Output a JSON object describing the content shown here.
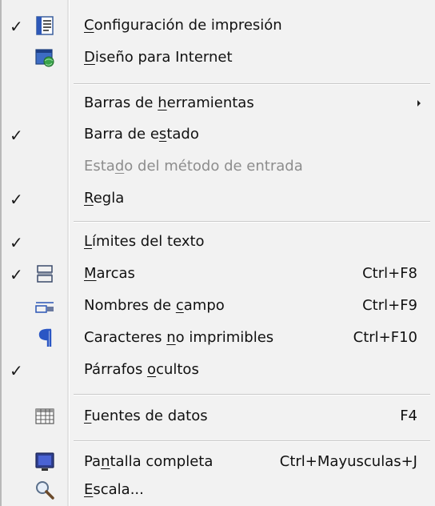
{
  "menu": {
    "items": [
      {
        "id": "configuracion",
        "pre": "",
        "mn": "C",
        "post": "onfiguración de impresión",
        "checked": true,
        "icon": "page-layout-icon",
        "shortcut": "",
        "disabled": false
      },
      {
        "id": "diseno",
        "pre": "",
        "mn": "D",
        "post": "iseño para Internet",
        "checked": false,
        "icon": "web-layout-icon",
        "shortcut": "",
        "disabled": false
      },
      {
        "id": "barras",
        "pre": "Barras de ",
        "mn": "h",
        "post": "erramientas",
        "checked": false,
        "icon": "",
        "shortcut": "",
        "disabled": false,
        "submenu": true
      },
      {
        "id": "barra-estado",
        "pre": "Barra de e",
        "mn": "s",
        "post": "tado",
        "checked": true,
        "icon": "",
        "shortcut": "",
        "disabled": false
      },
      {
        "id": "estado-metodo",
        "pre": "Esta",
        "mn": "d",
        "post": "o del método de entrada",
        "checked": false,
        "icon": "",
        "shortcut": "",
        "disabled": true
      },
      {
        "id": "regla",
        "pre": "",
        "mn": "R",
        "post": "egla",
        "checked": true,
        "icon": "",
        "shortcut": "",
        "disabled": false
      },
      {
        "id": "limites",
        "pre": "",
        "mn": "L",
        "post": "ímites del texto",
        "checked": true,
        "icon": "",
        "shortcut": "",
        "disabled": false
      },
      {
        "id": "marcas",
        "pre": "",
        "mn": "M",
        "post": "arcas",
        "checked": true,
        "icon": "field-shadings-icon",
        "shortcut": "Ctrl+F8",
        "disabled": false
      },
      {
        "id": "nombres",
        "pre": "Nombres de ",
        "mn": "c",
        "post": "ampo",
        "checked": false,
        "icon": "field-names-icon",
        "shortcut": "Ctrl+F9",
        "disabled": false
      },
      {
        "id": "caracteres",
        "pre": "Caracteres ",
        "mn": "n",
        "post": "o imprimibles",
        "checked": false,
        "icon": "pilcrow-icon",
        "shortcut": "Ctrl+F10",
        "disabled": false
      },
      {
        "id": "parrafos",
        "pre": "Párrafos ",
        "mn": "o",
        "post": "cultos",
        "checked": true,
        "icon": "",
        "shortcut": "",
        "disabled": false
      },
      {
        "id": "fuentes",
        "pre": "",
        "mn": "F",
        "post": "uentes de datos",
        "checked": false,
        "icon": "data-sources-icon",
        "shortcut": "F4",
        "disabled": false
      },
      {
        "id": "pantalla",
        "pre": "Pa",
        "mn": "n",
        "post": "talla completa",
        "checked": false,
        "icon": "monitor-icon",
        "shortcut": "Ctrl+Mayusculas+J",
        "disabled": false
      },
      {
        "id": "escala",
        "pre": "",
        "mn": "E",
        "post": "scala...",
        "checked": false,
        "icon": "magnifier-icon",
        "shortcut": "",
        "disabled": false
      }
    ],
    "check_glyph": "✓"
  },
  "colors": {
    "text": "#111111",
    "disabled_text": "#8d8d8d",
    "icon_blue": "#1f4fb4",
    "separator": "#c9c9c9"
  }
}
